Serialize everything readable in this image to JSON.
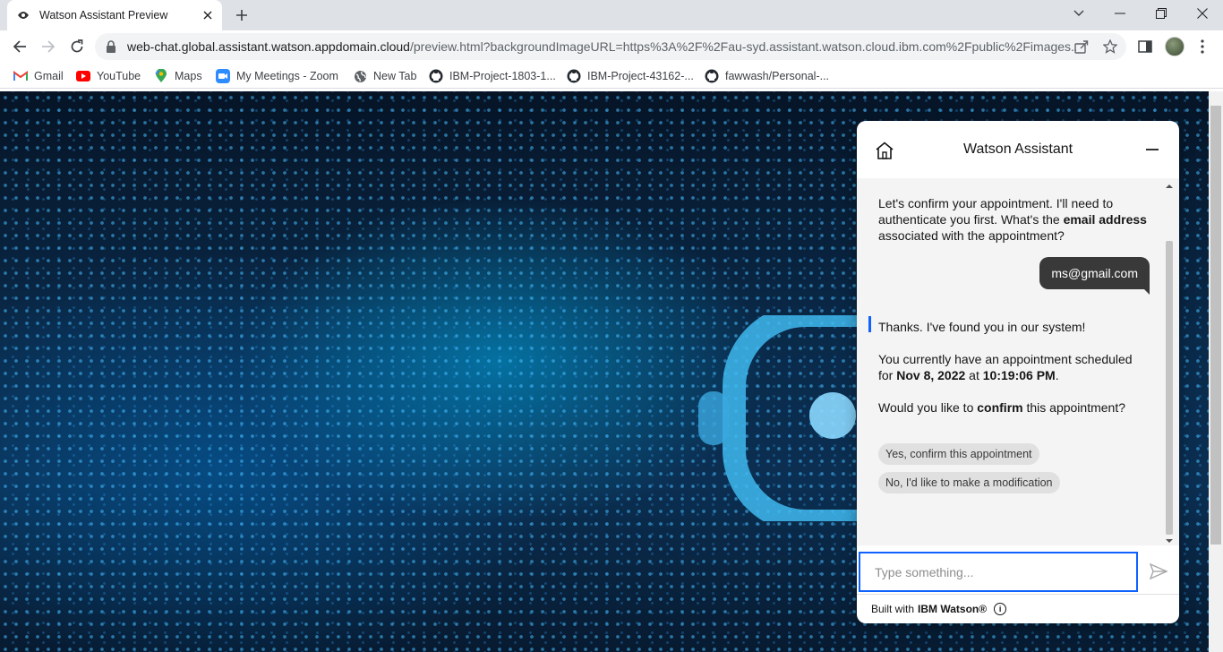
{
  "browser": {
    "tab_title": "Watson Assistant Preview",
    "url_host": "web-chat.global.assistant.watson.appdomain.cloud",
    "url_rest": "/preview.html?backgroundImageURL=https%3A%2F%2Fau-syd.assistant.watson.cloud.ibm.com%2Fpublic%2Fimages...",
    "bookmarks": [
      {
        "label": "Gmail",
        "icon": "gmail-icon"
      },
      {
        "label": "YouTube",
        "icon": "youtube-icon"
      },
      {
        "label": "Maps",
        "icon": "maps-icon"
      },
      {
        "label": "My Meetings - Zoom",
        "icon": "zoom-icon"
      },
      {
        "label": "New Tab",
        "icon": "globe-icon"
      },
      {
        "label": "IBM-Project-1803-1...",
        "icon": "github-icon"
      },
      {
        "label": "IBM-Project-43162-...",
        "icon": "github-icon"
      },
      {
        "label": "fawwash/Personal-...",
        "icon": "github-icon"
      }
    ]
  },
  "chat": {
    "title": "Watson Assistant",
    "messages": {
      "bot1_part1": "Let's confirm your appointment. I'll need to",
      "bot1_part2": "authenticate you first. What's the ",
      "bot1_bold": "email address",
      "bot1_part3": "associated with the appointment?",
      "user_email": "ms@gmail.com",
      "bot2_line1": "Thanks. I've found you in our system!",
      "bot2_line2": "You currently have an appointment scheduled",
      "bot2_for": "for ",
      "bot2_date": "Nov 8, 2022",
      "bot2_at": " at ",
      "bot2_time": "10:19:06 PM",
      "bot2_period": ".",
      "bot2_q_start": "Would you like to ",
      "bot2_q_bold": "confirm",
      "bot2_q_end": " this appointment?"
    },
    "options": [
      "Yes, confirm this appointment",
      "No, I'd like to make a modification"
    ],
    "help_label": "?",
    "input_placeholder": "Type something...",
    "footer_prefix": "Built with",
    "footer_brand": "IBM Watson®",
    "footer_info": "i"
  },
  "colors": {
    "accent": "#0f62fe",
    "user_bubble": "#393939",
    "chat_body": "#f4f4f4"
  }
}
